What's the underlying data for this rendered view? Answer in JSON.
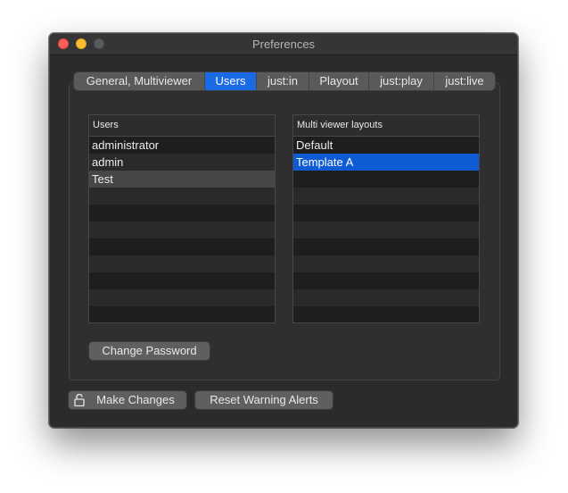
{
  "window": {
    "title": "Preferences"
  },
  "tabs": [
    {
      "label": "General, Multiviewer",
      "active": false
    },
    {
      "label": "Users",
      "active": true
    },
    {
      "label": "just:in",
      "active": false
    },
    {
      "label": "Playout",
      "active": false
    },
    {
      "label": "just:play",
      "active": false
    },
    {
      "label": "just:live",
      "active": false
    }
  ],
  "users_list": {
    "header": "Users",
    "items": [
      "administrator",
      "admin",
      "Test"
    ],
    "selected": "Test"
  },
  "layouts_list": {
    "header": "Multi viewer layouts",
    "items": [
      "Default",
      "Template A"
    ],
    "selected": "Template A"
  },
  "buttons": {
    "change_password": "Change Password",
    "make_changes": "Make Changes",
    "reset_warning_alerts": "Reset Warning Alerts"
  },
  "colors": {
    "accent": "#1a6ae3",
    "selection": "#0f5bd4",
    "close": "#fe5f57",
    "minimize": "#febc2e"
  },
  "icons": {
    "lock": "lock-open-icon"
  }
}
